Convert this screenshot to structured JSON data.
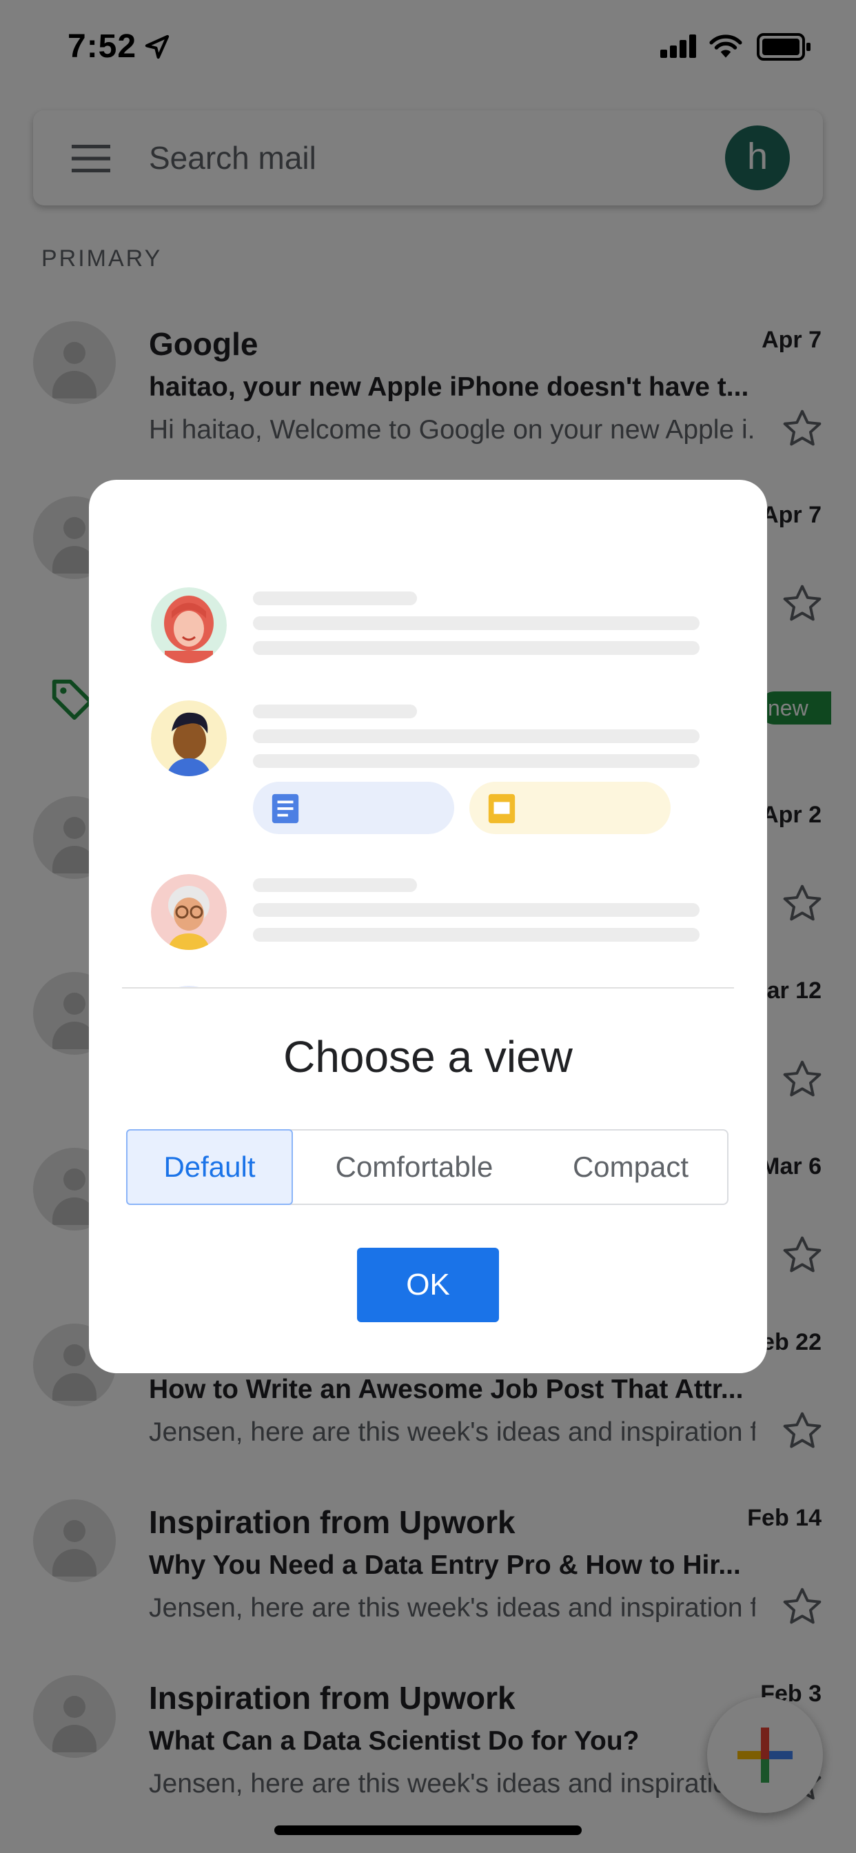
{
  "status_bar": {
    "time": "7:52"
  },
  "search": {
    "placeholder": "Search mail",
    "avatar_letter": "h"
  },
  "section_label": "PRIMARY",
  "emails": [
    {
      "sender": "Google",
      "date": "Apr 7",
      "subject": "haitao, your new Apple iPhone doesn't have t...",
      "snippet": "Hi haitao, Welcome to Google on your new Apple i..."
    },
    {
      "sender": "",
      "date": "Apr 7",
      "subject": "",
      "snippet": ""
    },
    {
      "sender": "",
      "date": "Apr 2",
      "subject": "",
      "snippet": ""
    },
    {
      "sender": "",
      "date": "ar 12",
      "subject": "",
      "snippet": ""
    },
    {
      "sender": "",
      "date": "Mar 6",
      "subject": "",
      "snippet": ""
    },
    {
      "sender": "",
      "date": "eb 22",
      "subject": "How to Write an Awesome Job Post That Attr...",
      "snippet": "Jensen, here are this week's ideas and inspiration f..."
    },
    {
      "sender": "Inspiration from Upwork",
      "date": "Feb 14",
      "subject": "Why You Need a Data Entry Pro & How to Hir...",
      "snippet": "Jensen, here are this week's ideas and inspiration f..."
    },
    {
      "sender": "Inspiration from Upwork",
      "date": "Feb 3",
      "subject": "What Can a Data Scientist Do for You?",
      "snippet": "Jensen, here are this week's ideas and inspiration f..."
    }
  ],
  "new_badge": "new",
  "dialog": {
    "title": "Choose a view",
    "options": [
      "Default",
      "Comfortable",
      "Compact"
    ],
    "selected": "Default",
    "ok_label": "OK"
  },
  "colors": {
    "accent": "#1a73e8",
    "avatar_bg": "#1e6b5c",
    "selected_bg": "#e8f0fe",
    "badge_green": "#1e8e3e"
  },
  "icons": [
    "location-arrow-icon",
    "signal-icon",
    "wifi-icon",
    "battery-icon",
    "menu-icon",
    "star-icon",
    "tag-icon",
    "compose-plus-icon",
    "document-icon",
    "slides-icon"
  ]
}
